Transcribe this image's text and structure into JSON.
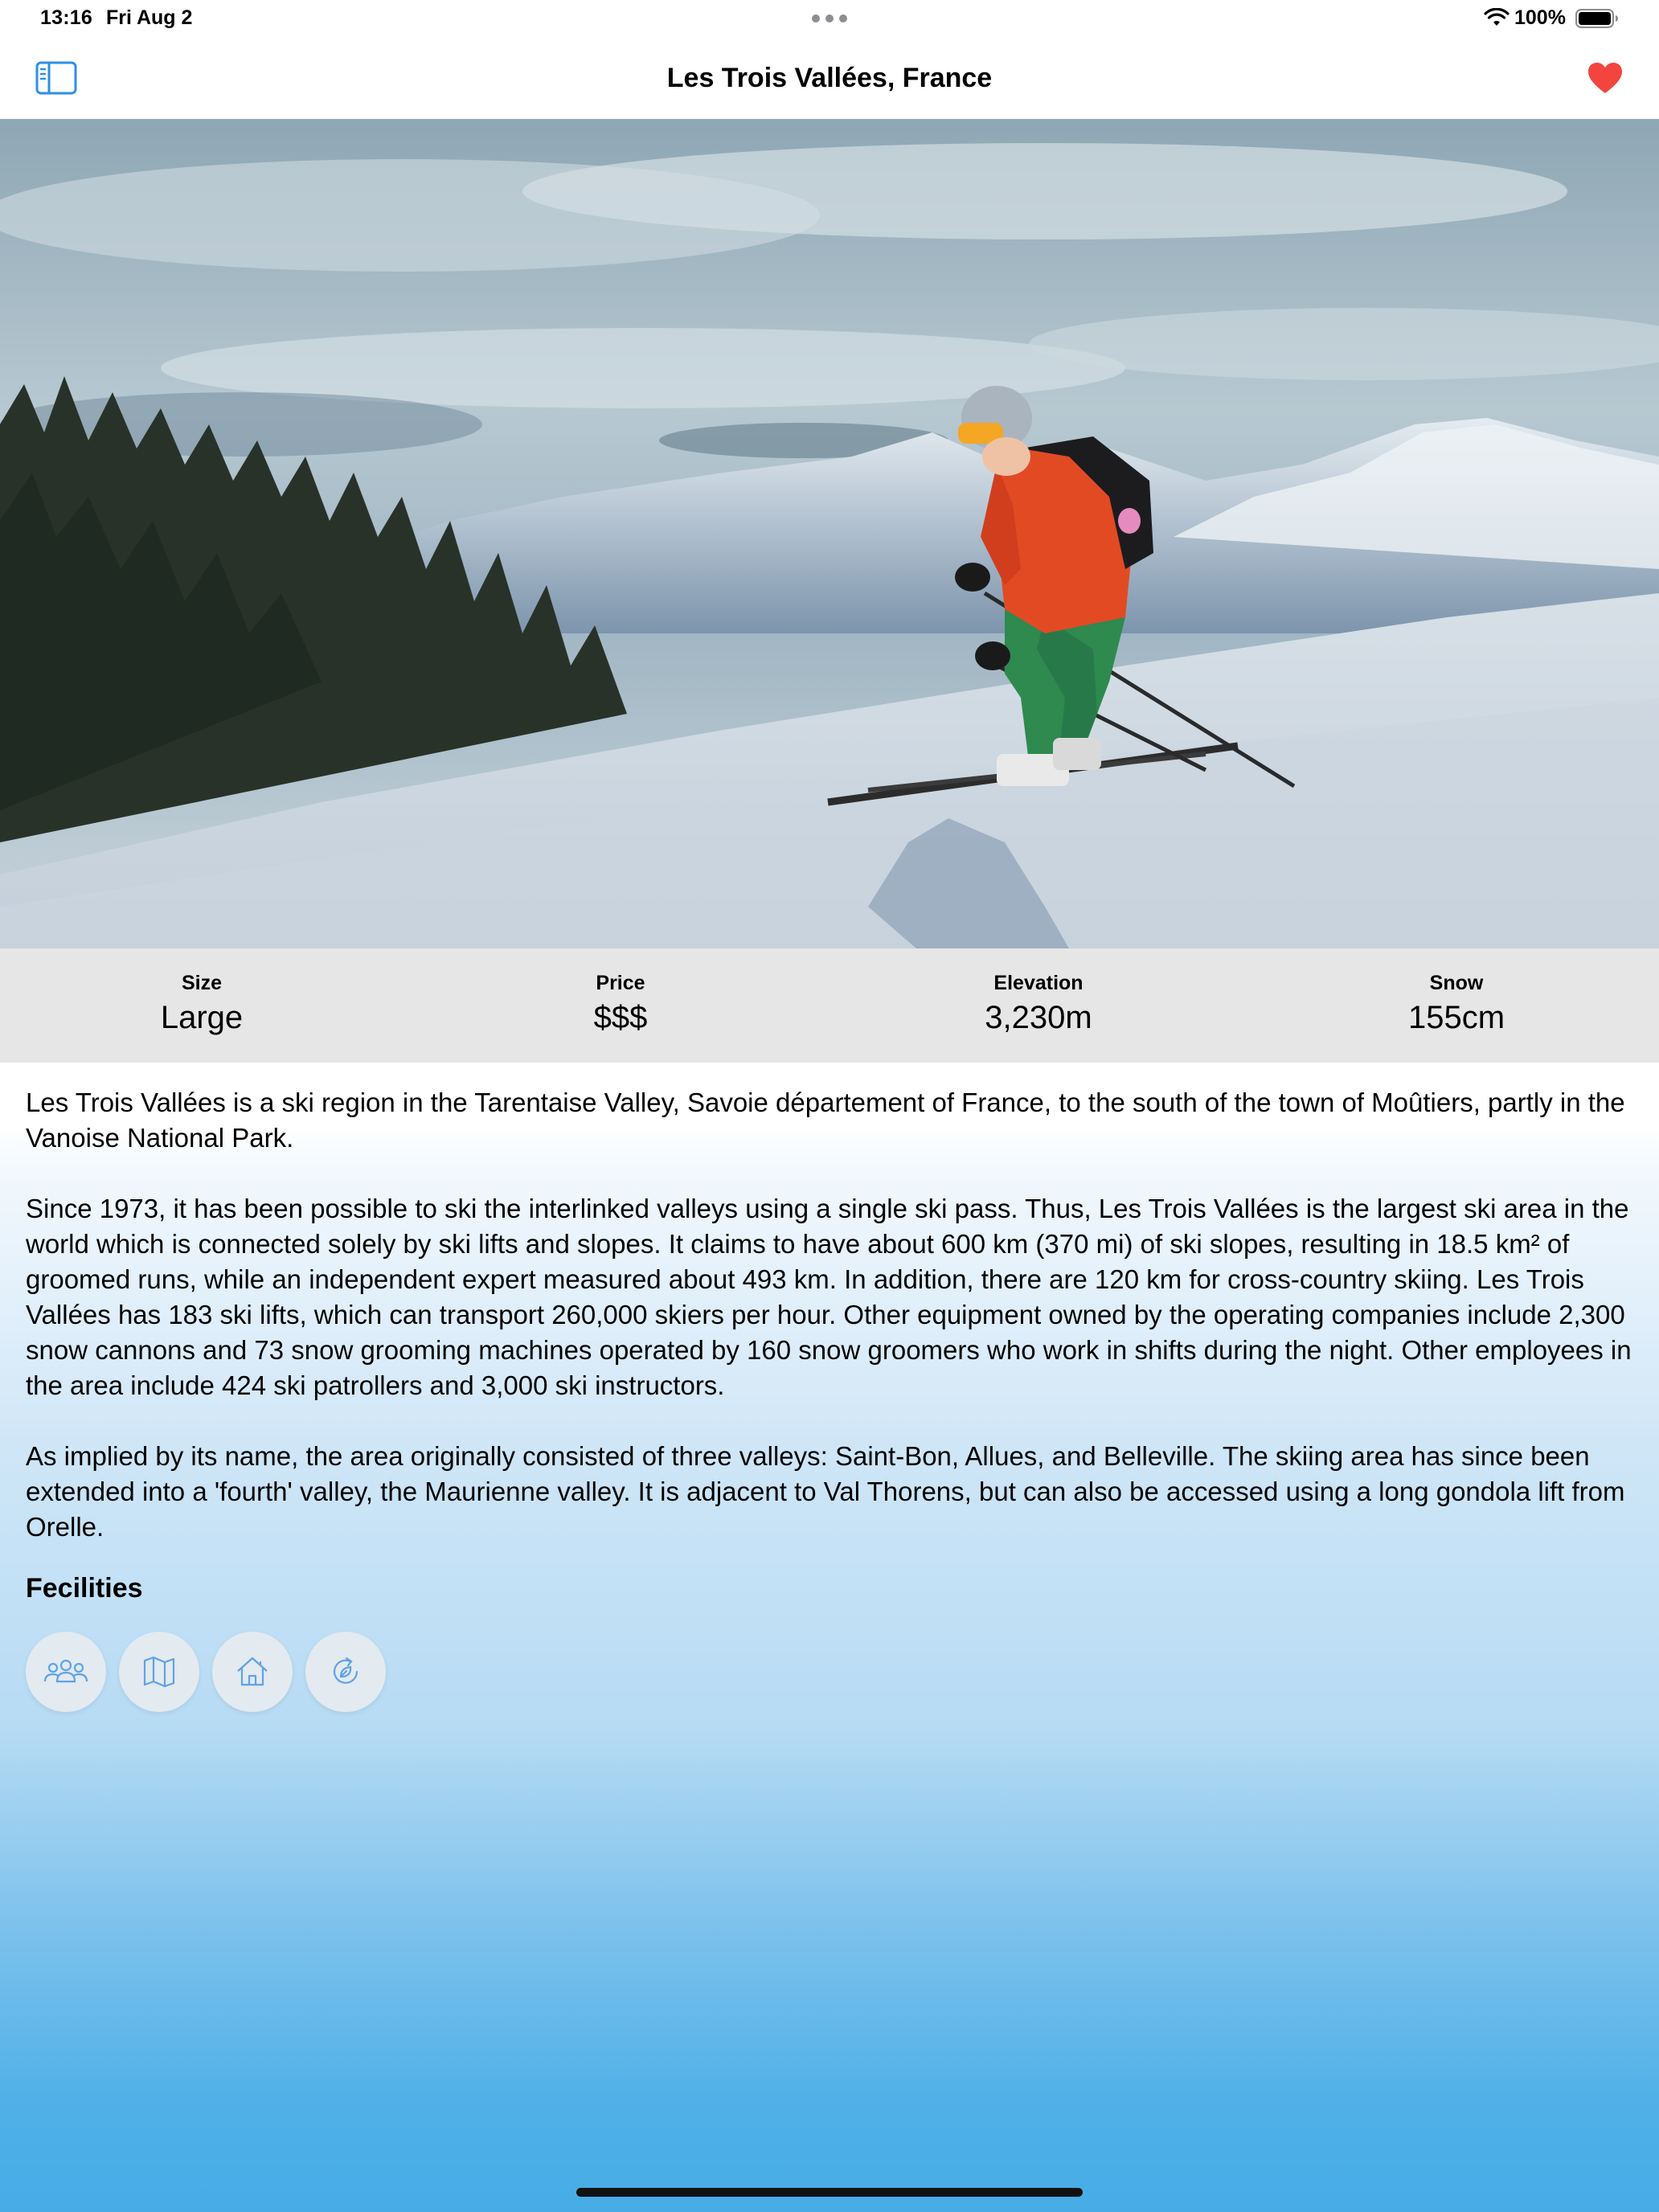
{
  "status_bar": {
    "time": "13:16",
    "date": "Fri Aug 2",
    "battery": "100%"
  },
  "nav": {
    "title": "Les Trois Vallées, France",
    "sidebar_icon": "sidebar-left-icon",
    "favorite_icon": "heart-filled-icon",
    "favorite_color": "#f2453d",
    "accent_color": "#2f8fe6"
  },
  "hero": {
    "icon": "skier-photo"
  },
  "stats": [
    {
      "label": "Size",
      "value": "Large"
    },
    {
      "label": "Price",
      "value": "$$$"
    },
    {
      "label": "Elevation",
      "value": "3,230m"
    },
    {
      "label": "Snow",
      "value": "155cm"
    }
  ],
  "description": [
    "Les Trois Vallées is a ski region in the Tarentaise Valley, Savoie département of France, to the south of the town of Moûtiers, partly in the Vanoise National Park.",
    "Since 1973, it has been possible to ski the interlinked valleys using a single ski pass. Thus, Les Trois Vallées is the largest ski area in the world which is connected solely by ski lifts and slopes. It claims to have about 600 km (370 mi) of ski slopes, resulting in 18.5 km² of groomed runs, while an independent expert measured about 493 km. In addition, there are 120 km for cross-country skiing. Les Trois Vallées has 183 ski lifts, which can transport 260,000 skiers per hour. Other equipment owned by the operating companies include 2,300 snow cannons and 73 snow grooming machines operated by 160 snow groomers who work in shifts during the night. Other employees in the area include 424 ski patrollers and 3,000 ski instructors.",
    "As implied by its name, the area originally consisted of three valleys: Saint-Bon, Allues, and Belleville. The skiing area has since been extended into a 'fourth' valley, the Maurienne valley. It is adjacent to Val Thorens, but can also be accessed using a long gondola lift from Orelle."
  ],
  "facilities": {
    "title": "Fecilities",
    "icons": [
      "people-icon",
      "map-icon",
      "house-icon",
      "eco-cycle-icon"
    ]
  }
}
